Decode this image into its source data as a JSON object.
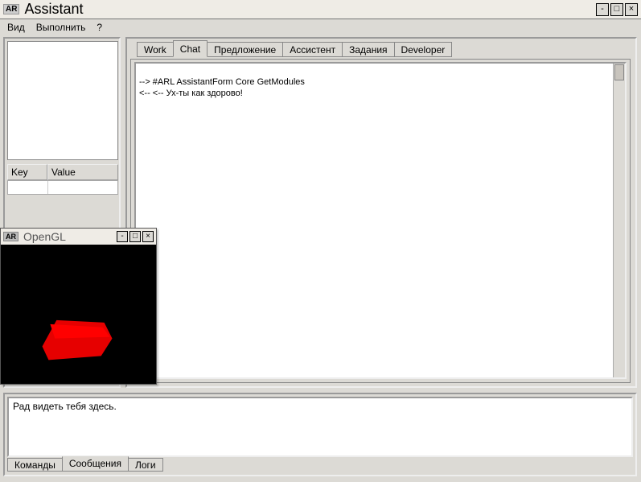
{
  "window": {
    "badge": "AR",
    "title": "Assistant"
  },
  "menu": {
    "view": "Вид",
    "run": "Выполнить",
    "help": "?"
  },
  "left": {
    "kv_key_header": "Key",
    "kv_val_header": "Value"
  },
  "tabs_top": {
    "work": "Work",
    "chat": "Chat",
    "offer": "Предложение",
    "assistant": "Ассистент",
    "tasks": "Задания",
    "developer": "Developer",
    "active": "chat"
  },
  "chat": {
    "line1": "--> #ARL AssistantForm Core GetModules",
    "line2": "<-- <-- Ух-ты как здорово!"
  },
  "bottom": {
    "message": "Рад видеть тебя здесь."
  },
  "tabs_bottom": {
    "commands": "Команды",
    "messages": "Сообщения",
    "logs": "Логи",
    "active": "messages"
  },
  "gl_window": {
    "badge": "AR",
    "title": "OpenGL"
  }
}
